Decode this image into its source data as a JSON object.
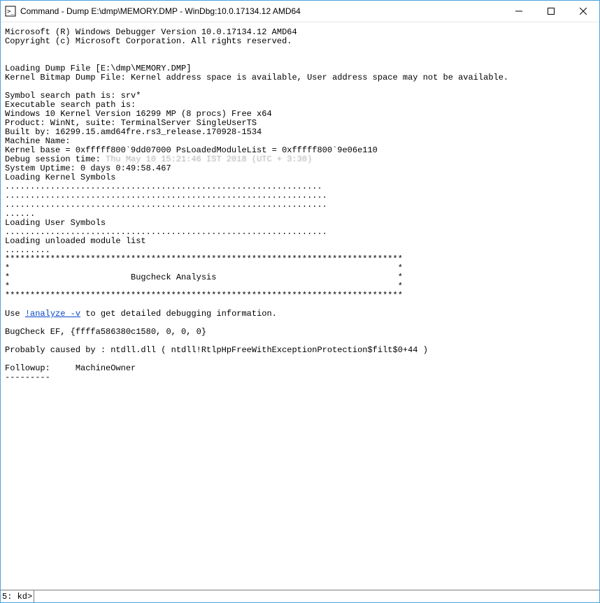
{
  "window": {
    "title": "Command - Dump E:\\dmp\\MEMORY.DMP - WinDbg:10.0.17134.12 AMD64"
  },
  "output": {
    "line1": "Microsoft (R) Windows Debugger Version 10.0.17134.12 AMD64",
    "line2": "Copyright (c) Microsoft Corporation. All rights reserved.",
    "blank1": "",
    "blank2": "",
    "l3": "Loading Dump File [E:\\dmp\\MEMORY.DMP]",
    "l4": "Kernel Bitmap Dump File: Kernel address space is available, User address space may not be available.",
    "blank3": "",
    "l5": "Symbol search path is: srv*",
    "l6": "Executable search path is: ",
    "l7": "Windows 10 Kernel Version 16299 MP (8 procs) Free x64",
    "l8": "Product: WinNt, suite: TerminalServer SingleUserTS",
    "l9": "Built by: 16299.15.amd64fre.rs3_release.170928-1534",
    "l10": "Machine Name:",
    "l11": "Kernel base = 0xfffff800`9dd07000 PsLoadedModuleList = 0xfffff800`9e06e110",
    "l12a": "Debug session time: ",
    "l12b_blur": "Thu May 10 15:21:46 IST 2018 (UTC + 3:30)",
    "l13": "System Uptime: 0 days 0:49:58.467",
    "l14": "Loading Kernel Symbols",
    "dots1": "...............................................................",
    "dots2": "................................................................",
    "dots3": "................................................................",
    "dots4": "......",
    "l15": "Loading User Symbols",
    "dots5": "................................................................",
    "l16": "Loading unloaded module list",
    "dots6": ".........",
    "star_top": "*******************************************************************************",
    "star_mid1": "*                                                                             *",
    "star_title": "*                        Bugcheck Analysis                                    *",
    "star_mid2": "*                                                                             *",
    "star_bot": "*******************************************************************************",
    "blank4": "",
    "use_prefix": "Use ",
    "analyze_link": "!analyze -v",
    "use_suffix": " to get detailed debugging information.",
    "blank5": "",
    "l17": "BugCheck EF, {ffffa586380c1580, 0, 0, 0}",
    "blank6": "",
    "l18": "Probably caused by : ntdll.dll ( ntdll!RtlpHpFreeWithExceptionProtection$filt$0+44 )",
    "blank7": "",
    "l19": "Followup:     MachineOwner",
    "l20": "---------"
  },
  "prompt": {
    "label": "5: kd>",
    "value": ""
  }
}
